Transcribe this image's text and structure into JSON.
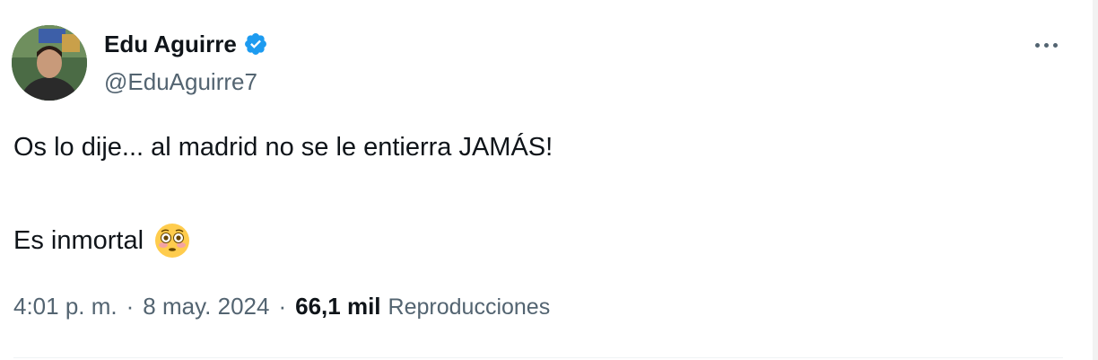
{
  "tweet": {
    "author": {
      "display_name": "Edu Aguirre",
      "handle": "@EduAguirre7",
      "verified_icon": "verified-badge-icon",
      "verified_color": "#1d9bf0"
    },
    "more_icon": "more-dots-icon",
    "text_line1": "Os lo dije... al madrid no se le entierra JAMÁS!",
    "text_line2": "Es inmortal",
    "emoji": "flushed-face-emoji",
    "time": "4:01 p. m.",
    "separator": "·",
    "date": "8 may. 2024",
    "views_count": "66,1 mil",
    "views_label": "Reproducciones"
  },
  "colors": {
    "primary_text": "#0f1419",
    "secondary_text": "#536471",
    "accent": "#1d9bf0"
  }
}
